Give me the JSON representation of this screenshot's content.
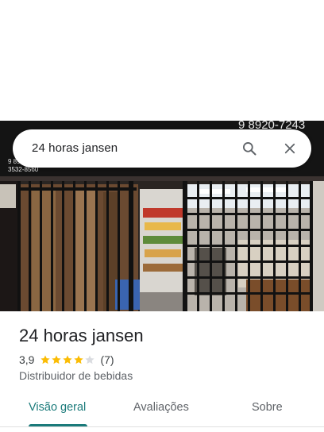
{
  "search": {
    "query": "24 horas jansen"
  },
  "photo": {
    "sign_phone_top": "9 8920-7243",
    "sign_phone_left_a": "9 89",
    "sign_phone_left_b": "3532-8560"
  },
  "place": {
    "name": "24 horas jansen",
    "rating": "3,9",
    "rating_value": 3.9,
    "review_count": "(7)",
    "category": "Distribuidor de bebidas"
  },
  "tabs": [
    {
      "label": "Visão geral",
      "active": true
    },
    {
      "label": "Avaliações",
      "active": false
    },
    {
      "label": "Sobre",
      "active": false
    }
  ],
  "colors": {
    "accent": "#1a7a7a",
    "star": "#fbbc04",
    "star_empty": "#dadce0"
  }
}
